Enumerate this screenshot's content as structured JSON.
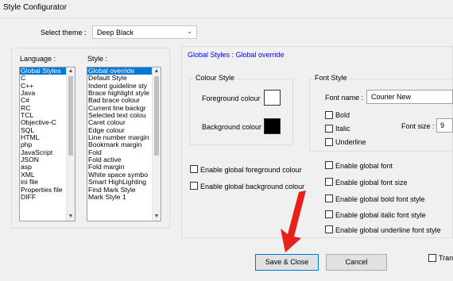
{
  "window": {
    "title": "Style Configurator"
  },
  "theme": {
    "label": "Select theme :",
    "value": "Deep Black"
  },
  "language_list": {
    "label": "Language :",
    "items": [
      "Global Styles",
      "C",
      "C++",
      "Java",
      "C#",
      "RC",
      "TCL",
      "Objective-C",
      "SQL",
      "HTML",
      "php",
      "JavaScript",
      "JSON",
      "asp",
      "XML",
      "ini file",
      "Properties file",
      "DIFF"
    ],
    "selected": "Global Styles"
  },
  "style_list": {
    "label": "Style :",
    "items": [
      "Global override",
      "Default Style",
      "Indent guideline sty",
      "Brace highlight style",
      "Bad brace colour",
      "Current line backgr",
      "Selected text colou",
      "Caret colour",
      "Edge colour",
      "Line number margin",
      "Bookmark margin",
      "Fold",
      "Fold active",
      "Fold margin",
      "White space symbo",
      "Smart HighLighting",
      "Find Mark Style",
      "Mark Style 1"
    ],
    "selected": "Global override"
  },
  "panel": {
    "title": "Global Styles : Global override"
  },
  "colour_style": {
    "label": "Colour Style",
    "foreground_label": "Foreground colour",
    "foreground_color": "#ffffff",
    "background_label": "Background colour",
    "background_color": "#000000"
  },
  "font_style": {
    "label": "Font Style",
    "font_name_label": "Font name :",
    "font_name_value": "Courier New",
    "bold_label": "Bold",
    "italic_label": "Italic",
    "underline_label": "Underline",
    "font_size_label": "Font size :",
    "font_size_value": "9"
  },
  "enable_options": {
    "global_foreground": "Enable global foreground colour",
    "global_background": "Enable global background colour",
    "global_font": "Enable global font",
    "global_font_size": "Enable global font size",
    "global_bold": "Enable global bold font style",
    "global_italic": "Enable global italic font style",
    "global_underline": "Enable global underline font style"
  },
  "buttons": {
    "save_close": "Save & Close",
    "cancel": "Cancel",
    "transparency": "Trans"
  },
  "annotation": {
    "arrow_color": "#e8201a"
  },
  "accent_color": "#0078d7",
  "panel_title_color": "#0000ff"
}
